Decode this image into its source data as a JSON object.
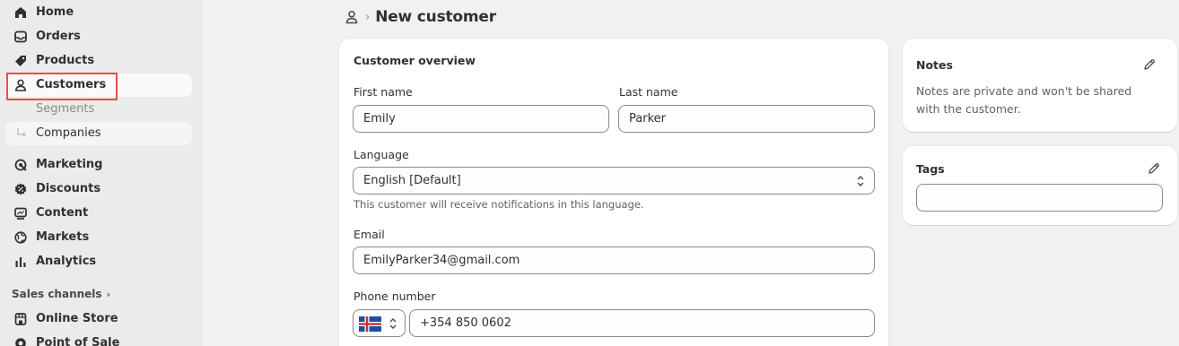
{
  "sidebar": {
    "items": [
      {
        "label": "Home",
        "icon": "home-icon"
      },
      {
        "label": "Orders",
        "icon": "inbox-icon"
      },
      {
        "label": "Products",
        "icon": "tag-icon"
      },
      {
        "label": "Customers",
        "icon": "person-icon"
      },
      {
        "label": "Segments"
      },
      {
        "label": "Companies",
        "icon": "sub-arrow-icon"
      },
      {
        "label": "Marketing",
        "icon": "target-icon"
      },
      {
        "label": "Discounts",
        "icon": "discount-icon"
      },
      {
        "label": "Content",
        "icon": "content-icon"
      },
      {
        "label": "Markets",
        "icon": "globe-icon"
      },
      {
        "label": "Analytics",
        "icon": "bar-chart-icon"
      },
      {
        "label": "Online Store",
        "icon": "store-icon"
      },
      {
        "label": "Point of Sale",
        "icon": "pos-icon"
      }
    ],
    "sales_channels": "Sales channels",
    "sales_channels_chevron": "›",
    "highlight_color": "#e2504d"
  },
  "header": {
    "separator": "›",
    "title": "New customer"
  },
  "overview": {
    "title": "Customer overview",
    "first_name_label": "First name",
    "first_name_value": "Emily",
    "last_name_label": "Last name",
    "last_name_value": "Parker",
    "language_label": "Language",
    "language_value": "English [Default]",
    "language_help": "This customer will receive notifications in this language.",
    "email_label": "Email",
    "email_value": "EmilyParker34@gmail.com",
    "phone_label": "Phone number",
    "phone_value": "+354 850 0602",
    "phone_country_flag": "Iceland"
  },
  "notes": {
    "title": "Notes",
    "text": "Notes are private and won't be shared with the customer."
  },
  "tags": {
    "title": "Tags",
    "input_value": ""
  }
}
